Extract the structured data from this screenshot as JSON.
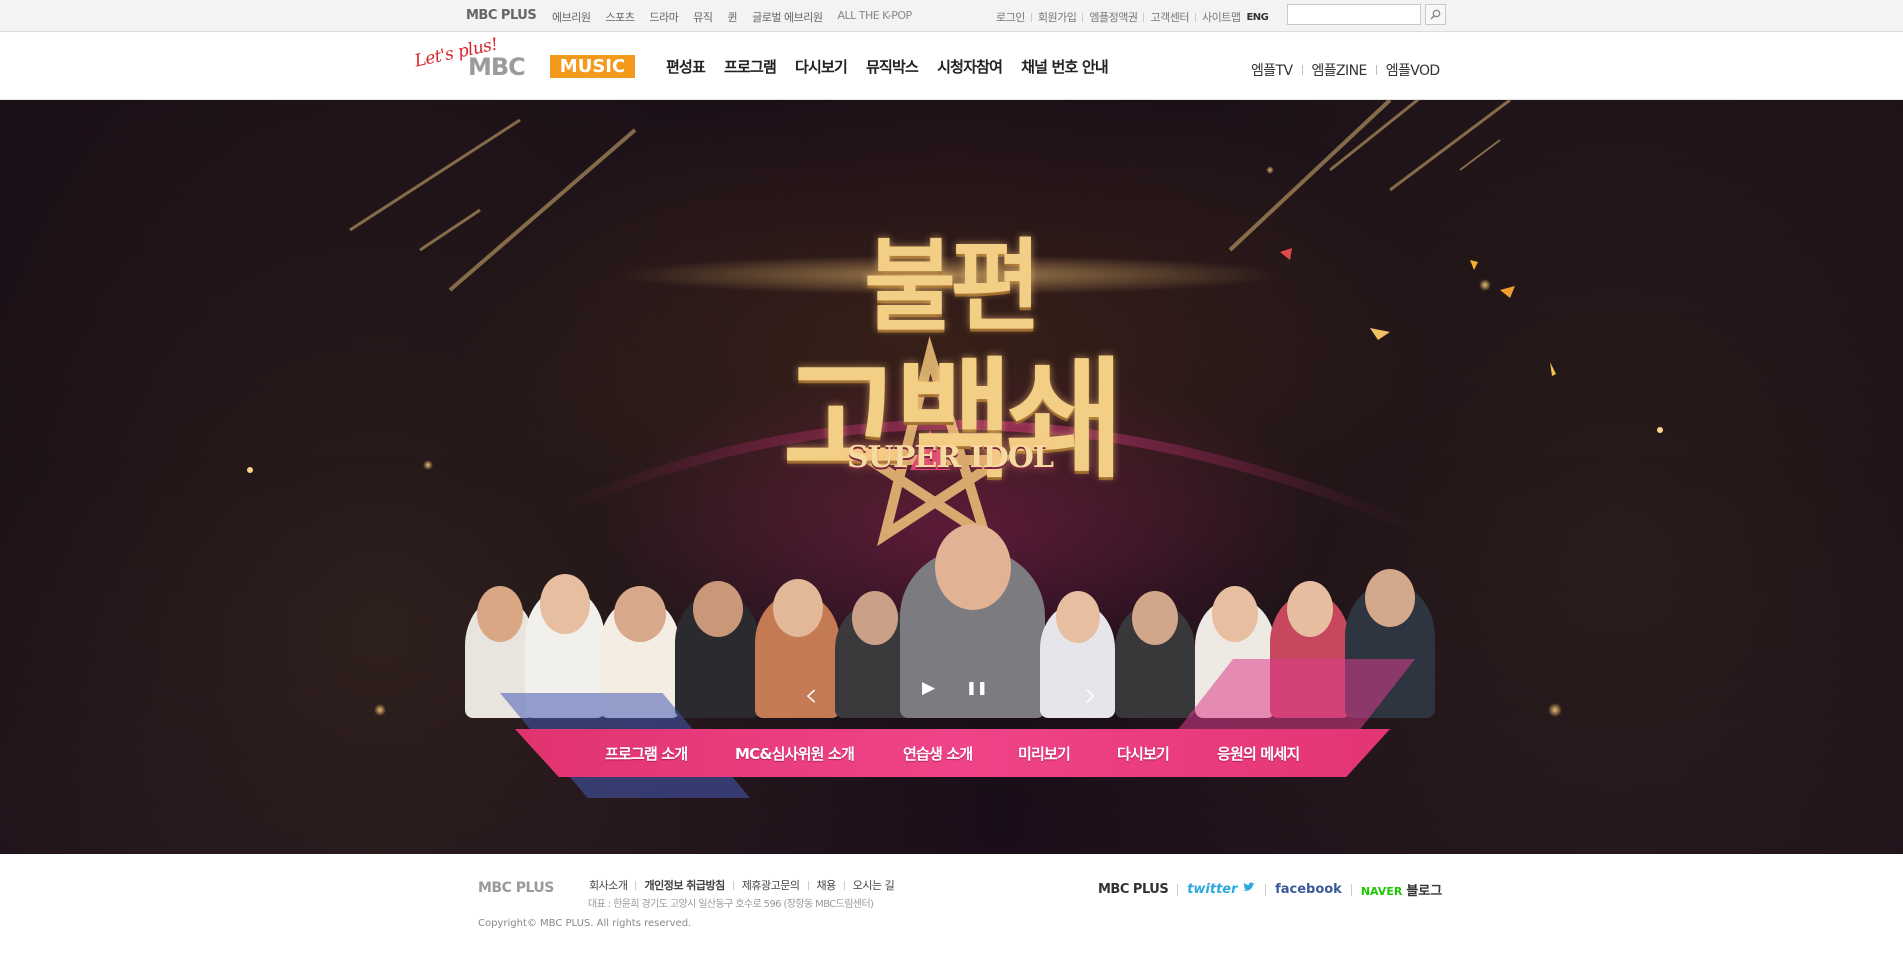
{
  "topbar": {
    "logo": "MBC PLUS",
    "family_links": [
      "에브리원",
      "스포츠",
      "드라마",
      "뮤직",
      "퀸",
      "글로벌 에브리원",
      "ALL THE K-POP"
    ],
    "util_links": [
      "로그인",
      "회원가입",
      "엠플정액권",
      "고객센터",
      "사이트맵"
    ],
    "eng": "ENG",
    "search_placeholder": ""
  },
  "header": {
    "slogan": "Let's plus!",
    "brand_mbc": "MBC",
    "brand_music": "MUSIC",
    "gnb": [
      "편성표",
      "프로그램",
      "다시보기",
      "뮤직박스",
      "시청자참여",
      "채널 번호 안내"
    ],
    "side_links": [
      "엠플TV",
      "엠플ZINE",
      "엠플VOD"
    ]
  },
  "hero": {
    "title_line1": "불편",
    "title_line2": "고백쇄",
    "super_idol": "SUPER IDOL",
    "prev_label": "‹",
    "next_label": "›",
    "play_label": "▶",
    "pause_label": "❚❚",
    "menu": [
      "프로그램 소개",
      "MC&심사위원 소개",
      "연습생 소개",
      "미리보기",
      "다시보기",
      "응원의 메세지"
    ]
  },
  "footer": {
    "logo": "MBC PLUS",
    "links": [
      "회사소개",
      "개인정보 취급방침",
      "제휴광고문의",
      "채용",
      "오시는 길"
    ],
    "address": "대표 : 한윤희   경기도 고양시 일산동구 호수로 596 (장항동 MBC드림센터)",
    "copyright": "Copyright© MBC PLUS.  All rights reserved.",
    "social": {
      "mbcplus": "MBC PLUS",
      "twitter": "twitter",
      "facebook": "facebook",
      "naver": "NAVER",
      "blog": "블로그"
    }
  },
  "colors": {
    "accent_orange": "#f39a1c",
    "hero_pink": "#e0336f",
    "twitter": "#2aa9e0",
    "facebook": "#3b5998",
    "naver": "#1ec800"
  }
}
